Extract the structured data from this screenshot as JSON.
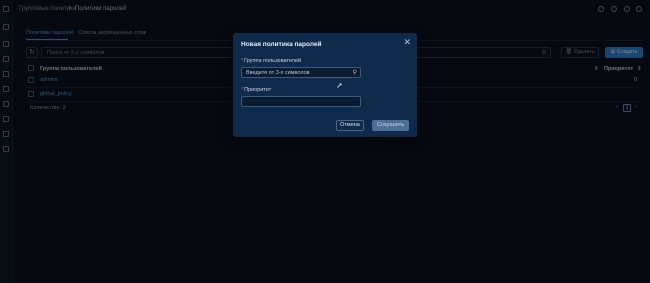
{
  "breadcrumb": {
    "part1": "Групповые политики",
    "separator": "/",
    "part2": "Политики паролей"
  },
  "tabs": [
    {
      "label": "Политики паролей"
    },
    {
      "label": "Список запрещенных слов"
    }
  ],
  "toolbar": {
    "search_placeholder": "Поиск от 3-х символов",
    "delete_label": "Удалить",
    "create_label": "Создать"
  },
  "table": {
    "headers": {
      "group": "Группа пользователей",
      "priority": "Приоритет"
    },
    "rows": [
      {
        "group": "admins",
        "priority": "0"
      },
      {
        "group": "global_policy",
        "priority": ""
      }
    ],
    "count_label": "Количество: 2",
    "current_page": "1"
  },
  "modal": {
    "title": "Новая политика паролей",
    "group_label": "Группа пользователей",
    "group_placeholder": "Введите от 3-х символов",
    "priority_label": "Приоритет",
    "priority_value": "",
    "cancel_label": "Отмена",
    "save_label": "Сохранить"
  },
  "colors": {
    "accent": "#3d93e6",
    "modal_bg": "#0f2a4a",
    "page_bg": "#0b121c"
  }
}
